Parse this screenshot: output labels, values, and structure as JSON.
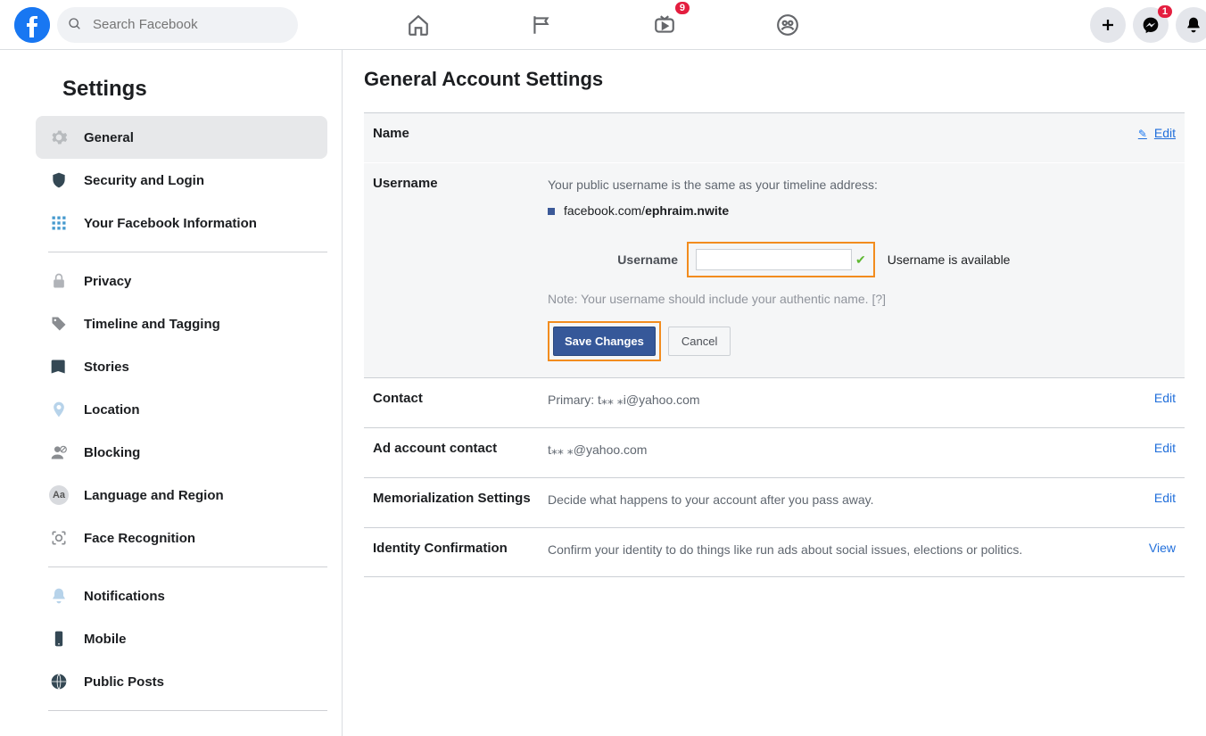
{
  "header": {
    "search_placeholder": "Search Facebook",
    "video_badge": "9",
    "messenger_badge": "1"
  },
  "sidebar": {
    "title": "Settings",
    "items": [
      {
        "label": "General",
        "icon": "gear-icon",
        "active": true
      },
      {
        "label": "Security and Login",
        "icon": "shield-icon"
      },
      {
        "label": "Your Facebook Information",
        "icon": "grid-icon"
      }
    ],
    "items2": [
      {
        "label": "Privacy",
        "icon": "lock-icon"
      },
      {
        "label": "Timeline and Tagging",
        "icon": "tag-icon"
      },
      {
        "label": "Stories",
        "icon": "book-icon"
      },
      {
        "label": "Location",
        "icon": "pin-icon"
      },
      {
        "label": "Blocking",
        "icon": "blocked-user-icon"
      },
      {
        "label": "Language and Region",
        "icon": "language-icon"
      },
      {
        "label": "Face Recognition",
        "icon": "face-icon"
      }
    ],
    "items3": [
      {
        "label": "Notifications",
        "icon": "bell-icon"
      },
      {
        "label": "Mobile",
        "icon": "mobile-icon"
      },
      {
        "label": "Public Posts",
        "icon": "globe-icon"
      }
    ]
  },
  "main": {
    "title": "General Account Settings",
    "name_section": {
      "title": "Name",
      "edit": "Edit"
    },
    "username_section": {
      "title": "Username",
      "desc": "Your public username is the same as your timeline address:",
      "url_prefix": "facebook.com/",
      "url_user": "ephraim.nwite",
      "input_label": "Username",
      "available_text": "Username is available",
      "note": "Note: Your username should include your authentic name.",
      "note_help": "[?]",
      "save_btn": "Save Changes",
      "cancel_btn": "Cancel"
    },
    "contact_section": {
      "title": "Contact",
      "value": "Primary: t⁎⁎         ⁎i@yahoo.com",
      "edit": "Edit"
    },
    "adcontact_section": {
      "title": "Ad account contact",
      "value": "t⁎⁎           ⁎@yahoo.com",
      "edit": "Edit"
    },
    "memorial_section": {
      "title": "Memorialization Settings",
      "value": "Decide what happens to your account after you pass away.",
      "edit": "Edit"
    },
    "identity_section": {
      "title": "Identity Confirmation",
      "value": "Confirm your identity to do things like run ads about social issues, elections or politics.",
      "edit": "View"
    }
  }
}
